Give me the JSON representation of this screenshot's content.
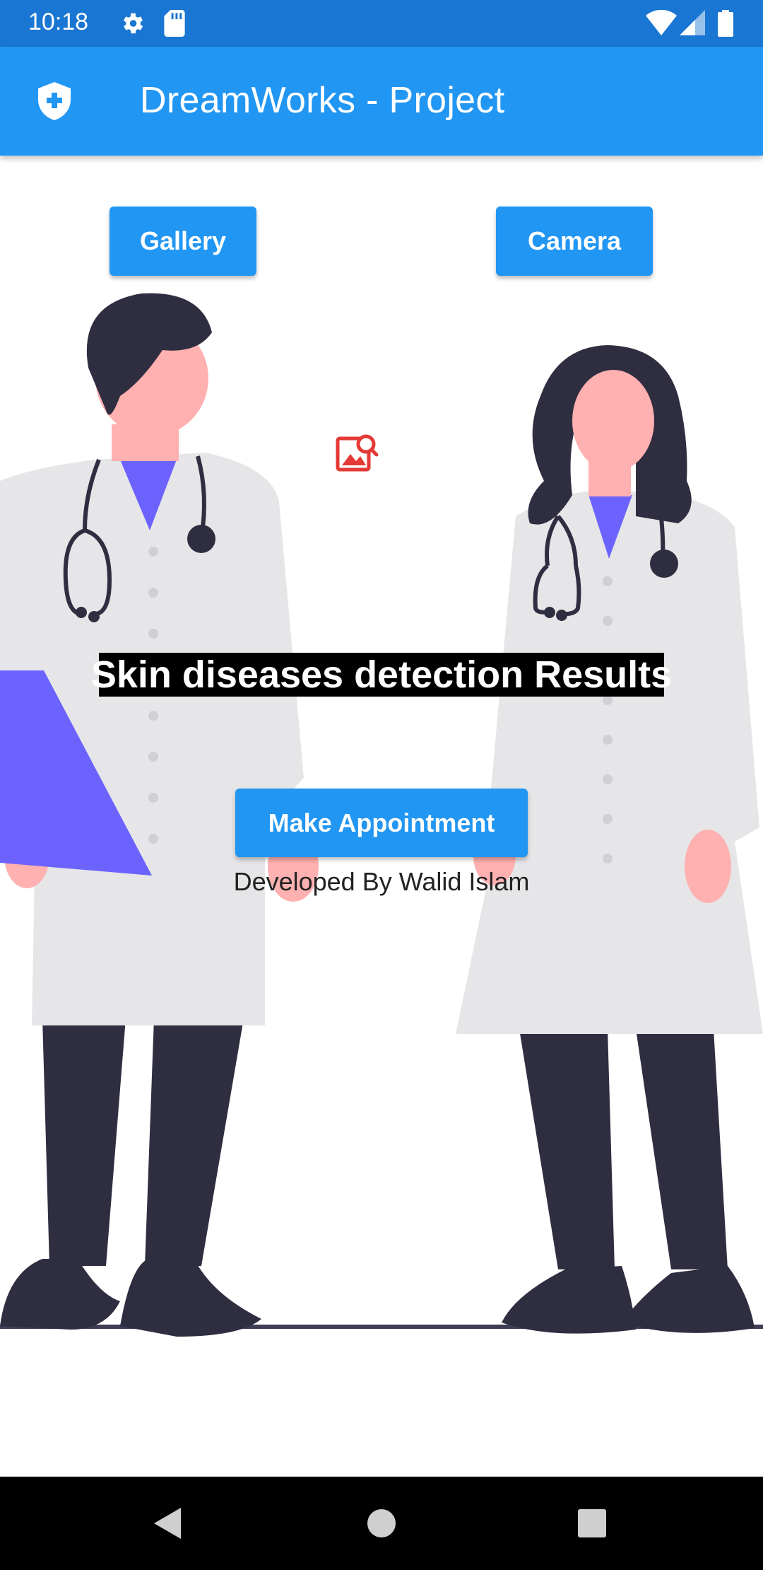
{
  "status_bar": {
    "time": "10:18",
    "icons": [
      "gear-icon",
      "sd-card-icon",
      "wifi-icon",
      "cell-signal-icon",
      "battery-icon"
    ]
  },
  "app_bar": {
    "icon": "shield-plus-icon",
    "title": "DreamWorks - Project"
  },
  "buttons": {
    "gallery": "Gallery",
    "camera": "Camera",
    "appointment": "Make Appointment"
  },
  "main": {
    "image_icon": "image-search-icon",
    "result_title": "Skin diseases detection Results",
    "credit": "Developed By Walid Islam"
  },
  "nav_bar": {
    "icons": [
      "back-triangle-icon",
      "home-circle-icon",
      "recents-square-icon"
    ]
  },
  "colors": {
    "primary": "#2196f3",
    "status_bar": "#1976d2",
    "icon_red": "#e53935",
    "coat": "#e6e6e8",
    "accent_purple": "#6c63ff",
    "dark": "#2f2e41",
    "skin": "#ffb0b0"
  }
}
